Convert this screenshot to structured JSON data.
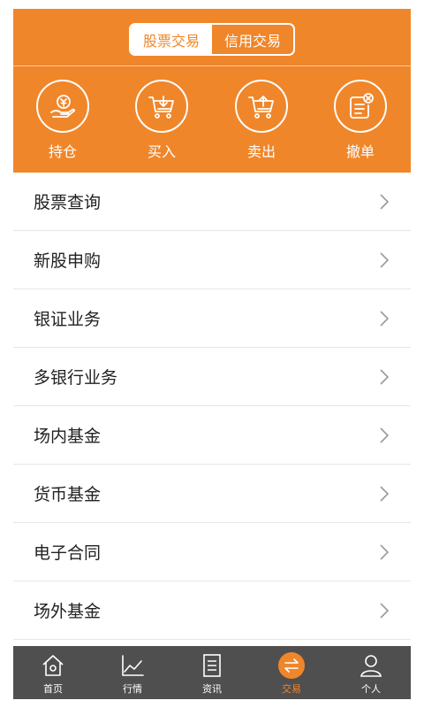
{
  "segment": {
    "active": "股票交易",
    "inactive": "信用交易"
  },
  "actions": [
    {
      "label": "持仓",
      "icon": "position-icon"
    },
    {
      "label": "买入",
      "icon": "cart-buy-icon"
    },
    {
      "label": "卖出",
      "icon": "cart-sell-icon"
    },
    {
      "label": "撤单",
      "icon": "cancel-order-icon"
    }
  ],
  "list": [
    "股票查询",
    "新股申购",
    "银证业务",
    "多银行业务",
    "场内基金",
    "货币基金",
    "电子合同",
    "场外基金"
  ],
  "tabs": [
    {
      "label": "首页",
      "icon": "home-icon"
    },
    {
      "label": "行情",
      "icon": "chart-icon"
    },
    {
      "label": "资讯",
      "icon": "news-icon"
    },
    {
      "label": "交易",
      "icon": "trade-icon",
      "active": true
    },
    {
      "label": "个人",
      "icon": "user-icon"
    }
  ],
  "colors": {
    "accent": "#f0862a",
    "tabbar": "#4f4f4f",
    "text": "#222222",
    "divider": "#e6e6e6"
  }
}
